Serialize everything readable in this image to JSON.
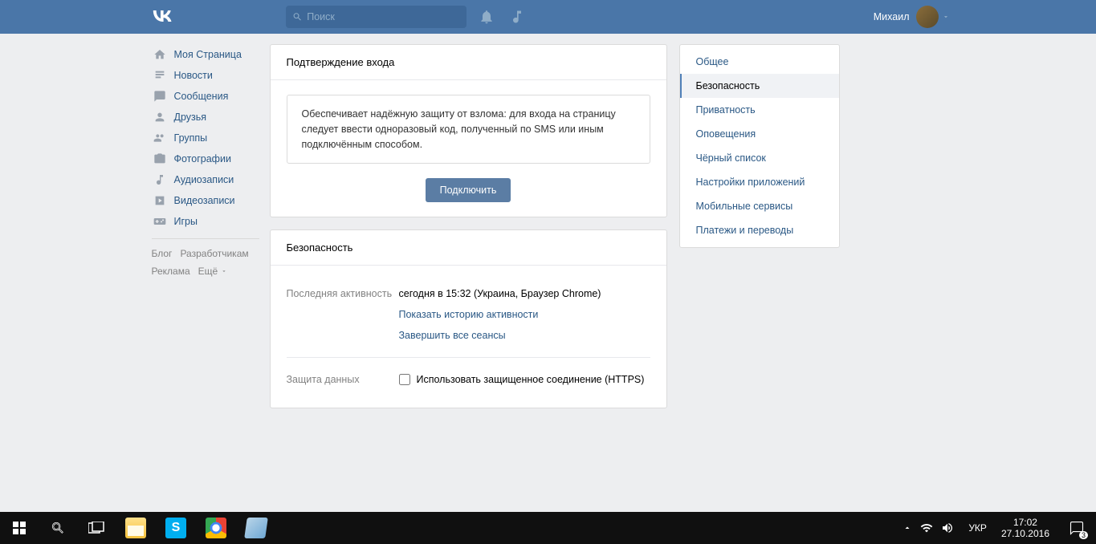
{
  "header": {
    "search_placeholder": "Поиск",
    "username": "Михаил"
  },
  "leftnav": {
    "items": [
      {
        "label": "Моя Страница"
      },
      {
        "label": "Новости"
      },
      {
        "label": "Сообщения"
      },
      {
        "label": "Друзья"
      },
      {
        "label": "Группы"
      },
      {
        "label": "Фотографии"
      },
      {
        "label": "Аудиозаписи"
      },
      {
        "label": "Видеозаписи"
      },
      {
        "label": "Игры"
      }
    ],
    "footer": {
      "blog": "Блог",
      "devs": "Разработчикам",
      "ads": "Реклама",
      "more": "Ещё"
    }
  },
  "main": {
    "panel1_title": "Подтверждение входа",
    "panel1_info": "Обеспечивает надёжную защиту от взлома: для входа на страницу следует ввести одноразовый код, полученный по SMS или иным подключённым способом.",
    "panel1_button": "Подключить",
    "panel2_title": "Безопасность",
    "last_activity_label": "Последняя активность",
    "last_activity_value": "сегодня в 15:32 (Украина, Браузер Chrome)",
    "show_history": "Показать историю активности",
    "end_sessions": "Завершить все сеансы",
    "data_protection_label": "Защита данных",
    "https_checkbox": "Использовать защищенное соединение (HTTPS)"
  },
  "righttabs": {
    "items": [
      {
        "label": "Общее"
      },
      {
        "label": "Безопасность"
      },
      {
        "label": "Приватность"
      },
      {
        "label": "Оповещения"
      },
      {
        "label": "Чёрный список"
      },
      {
        "label": "Настройки приложений"
      },
      {
        "label": "Мобильные сервисы"
      },
      {
        "label": "Платежи и переводы"
      }
    ],
    "active_index": 1
  },
  "taskbar": {
    "lang": "УКР",
    "time": "17:02",
    "date": "27.10.2016",
    "notif_count": "3"
  }
}
